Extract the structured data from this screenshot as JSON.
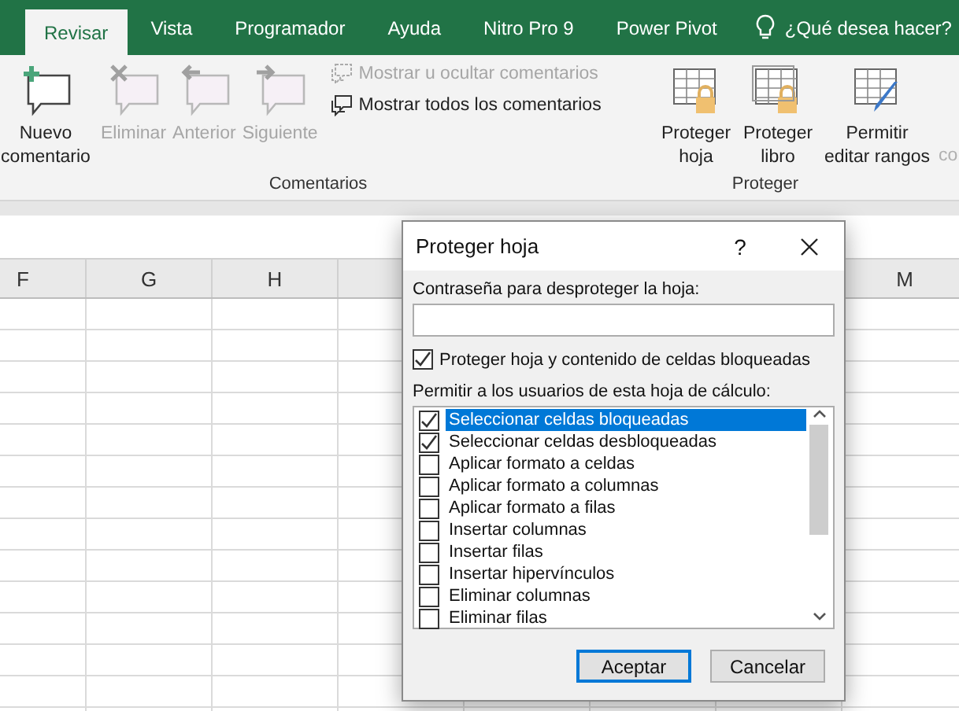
{
  "ribbon_tabs": [
    {
      "label": "Revisar",
      "selected": true
    },
    {
      "label": "Vista",
      "selected": false
    },
    {
      "label": "Programador",
      "selected": false
    },
    {
      "label": "Ayuda",
      "selected": false
    },
    {
      "label": "Nitro Pro 9",
      "selected": false
    },
    {
      "label": "Power Pivot",
      "selected": false
    }
  ],
  "tell_me": "¿Qué desea hacer?",
  "comments_group": {
    "label": "Comentarios",
    "large_buttons": [
      {
        "kind": "new",
        "label": "Nuevo comentario",
        "disabled": false
      },
      {
        "kind": "delete",
        "label": "Eliminar",
        "disabled": true
      },
      {
        "kind": "previous",
        "label": "Anterior",
        "disabled": true
      },
      {
        "kind": "next",
        "label": "Siguiente",
        "disabled": true
      }
    ],
    "small_buttons": [
      {
        "label": "Mostrar u ocultar comentarios",
        "disabled": true
      },
      {
        "label": "Mostrar todos los comentarios",
        "disabled": false
      }
    ]
  },
  "protect_group": {
    "label": "Proteger",
    "buttons": [
      {
        "kind": "sheet",
        "label": "Proteger hoja"
      },
      {
        "kind": "book",
        "label": "Proteger libro"
      },
      {
        "kind": "ranges",
        "label": "Permitir editar rangos"
      }
    ],
    "cut_label": "co"
  },
  "columns": [
    {
      "label": "F"
    },
    {
      "label": "G"
    },
    {
      "label": "H"
    },
    {},
    {},
    {},
    {},
    {
      "label": "M"
    }
  ],
  "dialog": {
    "title": "Proteger hoja",
    "help": "?",
    "password_label": "Contraseña para desproteger la hoja:",
    "protect_checkbox": {
      "label": "Proteger hoja y contenido de celdas bloqueadas",
      "checked": true
    },
    "permissions_label": "Permitir a los usuarios de esta hoja de cálculo:",
    "permissions": [
      {
        "label": "Seleccionar celdas bloqueadas",
        "checked": true,
        "selected": true
      },
      {
        "label": "Seleccionar celdas desbloqueadas",
        "checked": true,
        "selected": false
      },
      {
        "label": "Aplicar formato a celdas",
        "checked": false,
        "selected": false
      },
      {
        "label": "Aplicar formato a columnas",
        "checked": false,
        "selected": false
      },
      {
        "label": "Aplicar formato a filas",
        "checked": false,
        "selected": false
      },
      {
        "label": "Insertar columnas",
        "checked": false,
        "selected": false
      },
      {
        "label": "Insertar filas",
        "checked": false,
        "selected": false
      },
      {
        "label": "Insertar hipervínculos",
        "checked": false,
        "selected": false
      },
      {
        "label": "Eliminar columnas",
        "checked": false,
        "selected": false
      },
      {
        "label": "Eliminar filas",
        "checked": false,
        "selected": false
      }
    ],
    "buttons": [
      {
        "label": "Aceptar",
        "default": true
      },
      {
        "label": "Cancelar",
        "default": false
      }
    ]
  }
}
